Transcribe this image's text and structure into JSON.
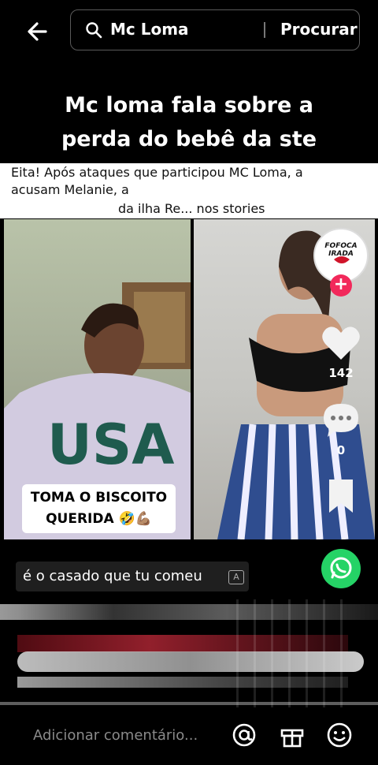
{
  "search": {
    "query": "Mc Loma",
    "submit_label": "Procurar"
  },
  "video": {
    "caption_lines": [
      "Mc loma fala sobre a",
      "perda do bebê da ste"
    ],
    "news_lines": [
      "Eita! Após ataques que participou MC Loma, a",
      "acusam Melanie, a",
      "da ilha Re... nos stories"
    ],
    "left_badge_lines": [
      "TOMA O BISCOITO",
      "QUERIDA 🤣💪🏽"
    ],
    "creator_badge": "FOFOCA IRADA",
    "like_count": "142",
    "comment_count": "0"
  },
  "comment_chip": {
    "text": "é o casado que tu comeu",
    "translate_icon_label": "A"
  },
  "composer": {
    "placeholder": "Adicionar comentário..."
  },
  "icons": {
    "back": "back-arrow-icon",
    "search": "search-icon",
    "like": "heart-icon",
    "comment": "comment-bubble-icon",
    "save": "bookmark-icon",
    "share": "whatsapp-icon",
    "mention": "at-sign-icon",
    "gift": "gift-icon",
    "emoji": "emoji-icon"
  },
  "colors": {
    "accent": "#f2295b",
    "whatsapp": "#25d366"
  }
}
